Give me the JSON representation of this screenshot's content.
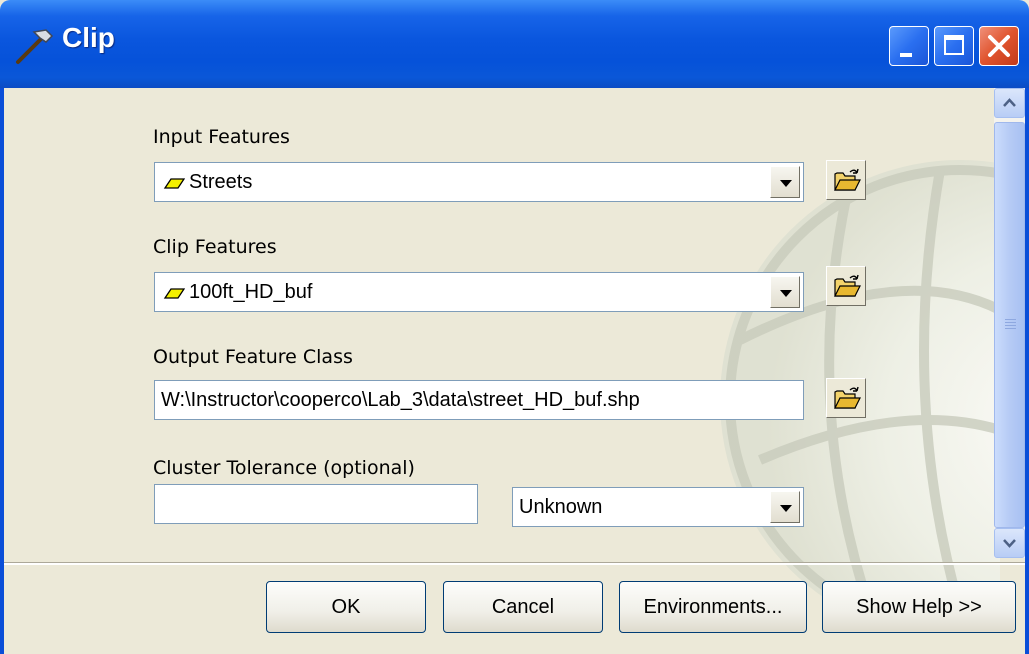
{
  "window": {
    "title": "Clip",
    "icon": "hammer-icon"
  },
  "title_buttons": [
    "minimize-icon",
    "maximize-icon",
    "close-icon"
  ],
  "fields": {
    "input_features": {
      "label": "Input Features",
      "value": "Streets",
      "icon": "polygon-layer-icon"
    },
    "clip_features": {
      "label": "Clip Features",
      "value": "100ft_HD_buf",
      "icon": "polygon-layer-icon"
    },
    "output_feature_class": {
      "label": "Output Feature Class",
      "value": "W:\\Instructor\\cooperco\\Lab_3\\data\\street_HD_buf.shp"
    },
    "cluster_tolerance": {
      "label": "Cluster Tolerance (optional)",
      "value": "",
      "unit": "Unknown"
    }
  },
  "buttons": {
    "ok": "OK",
    "cancel": "Cancel",
    "environments": "Environments...",
    "show_help": "Show Help >>"
  },
  "colors": {
    "titlebar": "#0a56de",
    "face": "#ece9d8",
    "close": "#e0542e"
  }
}
